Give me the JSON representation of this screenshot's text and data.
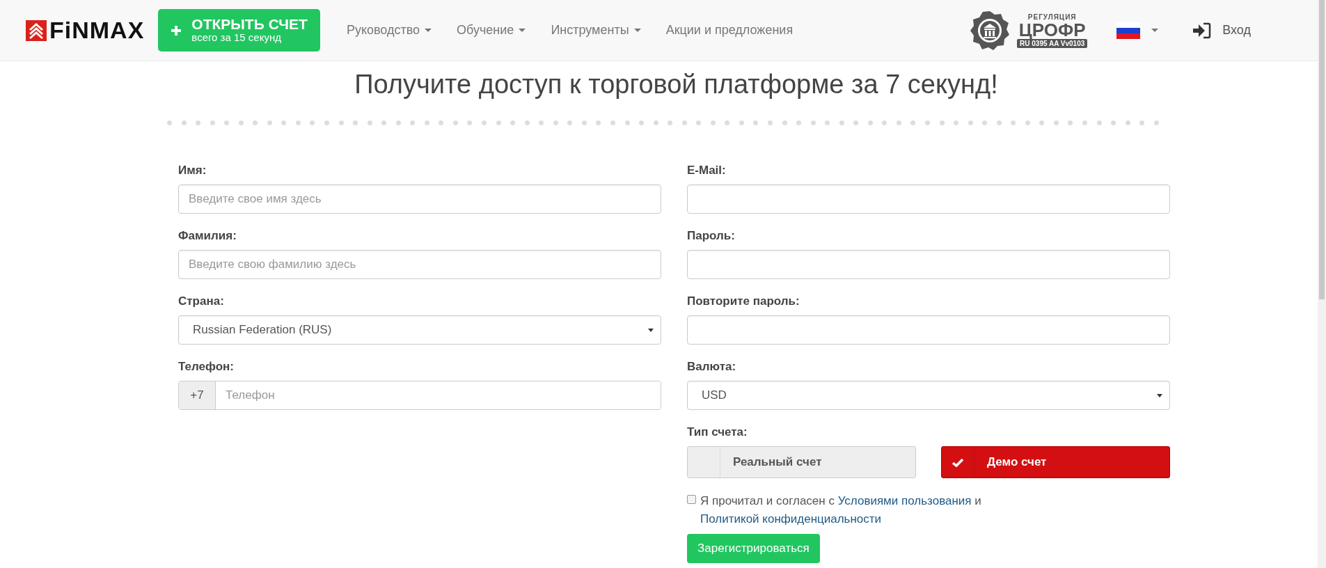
{
  "header": {
    "logo": "FiNMAX",
    "cta": {
      "title": "ОТКРЫТЬ СЧЕТ",
      "subtitle": "всего за 15 секунд"
    },
    "nav": [
      {
        "label": "Руководство",
        "dropdown": true
      },
      {
        "label": "Обучение",
        "dropdown": true
      },
      {
        "label": "Инструменты",
        "dropdown": true
      },
      {
        "label": "Акции и предложения",
        "dropdown": false
      }
    ],
    "regulation": {
      "caption": "РЕГУЛЯЦИЯ",
      "name": "ЦРОФР",
      "license": "RU 0395 AA Vv0103"
    },
    "login": "Вход"
  },
  "title": "Получите доступ к торговой платформе за 7 секунд!",
  "form": {
    "left": [
      {
        "kind": "text",
        "label": "Имя:",
        "placeholder": "Введите свое имя здесь"
      },
      {
        "kind": "text",
        "label": "Фамилия:",
        "placeholder": "Введите свою фамилию здесь"
      },
      {
        "kind": "select",
        "label": "Страна:",
        "value": "Russian Federation (RUS)"
      },
      {
        "kind": "phone",
        "label": "Телефон:",
        "prefix": "+7",
        "placeholder": "Телефон"
      }
    ],
    "right": [
      {
        "kind": "text",
        "label": "E-Mail:"
      },
      {
        "kind": "text",
        "label": "Пароль:"
      },
      {
        "kind": "text",
        "label": "Повторите пароль:"
      },
      {
        "kind": "select",
        "label": "Валюта:",
        "value": "USD"
      }
    ],
    "account_type": {
      "label": "Тип счета:",
      "options": [
        {
          "label": "Реальный счет",
          "selected": false
        },
        {
          "label": "Демо счет",
          "selected": true
        }
      ]
    },
    "agreement": {
      "checked": false,
      "text": "Я прочитал и согласен с",
      "link1": "Условиями пользования",
      "joiner": "и",
      "link2": "Политикой конфиденциальности"
    },
    "submit": "Зарегистрироваться"
  }
}
